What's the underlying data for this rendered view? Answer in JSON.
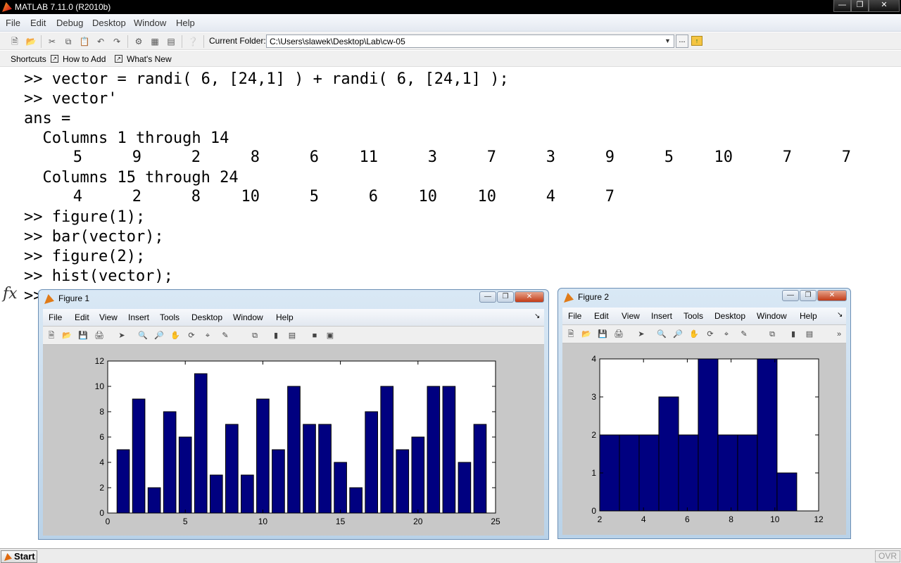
{
  "window": {
    "title": "MATLAB  7.11.0 (R2010b)"
  },
  "menu": [
    "File",
    "Edit",
    "Debug",
    "Desktop",
    "Window",
    "Help"
  ],
  "toolbar": {
    "current_folder_label": "Current Folder:",
    "current_folder_value": "C:\\Users\\slawek\\Desktop\\Lab\\cw-05",
    "browse_label": "..."
  },
  "shortcuts": {
    "label": "Shortcuts",
    "how_to_add": "How to Add",
    "whats_new": "What's New"
  },
  "command_window": {
    "lines": [
      ">> vector = randi( 6, [24,1] ) + randi( 6, [24,1] );",
      ">> vector'",
      "ans =",
      "  Columns 1 through 14",
      "  Columns 15 through 24",
      ">> figure(1);",
      ">> bar(vector);",
      ">> figure(2);",
      ">> hist(vector);",
      ">>"
    ],
    "row1": [
      5,
      9,
      2,
      8,
      6,
      11,
      3,
      7,
      3,
      9,
      5,
      10,
      7,
      7
    ],
    "row2": [
      4,
      2,
      8,
      10,
      5,
      6,
      10,
      10,
      4,
      7
    ],
    "fx_label": "fx"
  },
  "status": {
    "start_label": "Start",
    "ovr_label": "OVR"
  },
  "figure_menu": [
    "File",
    "Edit",
    "View",
    "Insert",
    "Tools",
    "Desktop",
    "Window",
    "Help"
  ],
  "figure1": {
    "title": "Figure 1"
  },
  "figure2": {
    "title": "Figure 2"
  },
  "chart_data": [
    {
      "type": "bar",
      "title": "",
      "xlabel": "",
      "ylabel": "",
      "x": [
        1,
        2,
        3,
        4,
        5,
        6,
        7,
        8,
        9,
        10,
        11,
        12,
        13,
        14,
        15,
        16,
        17,
        18,
        19,
        20,
        21,
        22,
        23,
        24
      ],
      "values": [
        5,
        9,
        2,
        8,
        6,
        11,
        3,
        7,
        3,
        9,
        5,
        10,
        7,
        7,
        4,
        2,
        8,
        10,
        5,
        6,
        10,
        10,
        4,
        7
      ],
      "xlim": [
        0,
        25
      ],
      "ylim": [
        0,
        12
      ],
      "xticks": [
        0,
        5,
        10,
        15,
        20,
        25
      ],
      "yticks": [
        0,
        2,
        4,
        6,
        8,
        10,
        12
      ],
      "bar_color": "#000080",
      "grid": false
    },
    {
      "type": "bar",
      "title": "",
      "xlabel": "",
      "ylabel": "",
      "bin_edges": [
        2,
        2.9,
        3.8,
        4.7,
        5.6,
        6.5,
        7.4,
        8.3,
        9.2,
        10.1,
        11
      ],
      "counts": [
        2,
        2,
        2,
        3,
        2,
        4,
        2,
        2,
        4,
        1
      ],
      "xlim": [
        2,
        12
      ],
      "ylim": [
        0,
        4
      ],
      "xticks": [
        2,
        4,
        6,
        8,
        10,
        12
      ],
      "yticks": [
        0,
        1,
        2,
        3,
        4
      ],
      "bar_color": "#000080",
      "grid": false
    }
  ]
}
